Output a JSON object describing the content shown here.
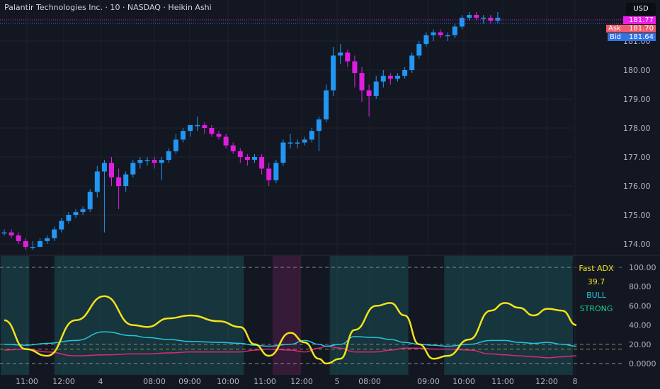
{
  "header": {
    "title": "Palantir Technologies Inc. · 10 · NASDAQ · Heikin Ashi",
    "currency": "USD"
  },
  "quotes": {
    "last": "181.77",
    "ask_label": "Ask",
    "ask": "181.70",
    "bid_label": "Bid",
    "bid": "181.64"
  },
  "colors": {
    "up": "#2196f3",
    "down": "#e01ee0",
    "adx": "#f5e21b",
    "plus_di": "#26c6da",
    "minus_di": "#e0287a",
    "last": "#e91ee9",
    "ask": "#f05a6a",
    "bid": "#2f74e8"
  },
  "price_axis": [
    "181.00",
    "180.00",
    "179.00",
    "178.00",
    "177.00",
    "176.00",
    "175.00",
    "174.00"
  ],
  "osc_axis": [
    "100.00",
    "80.00",
    "60.00",
    "40.00",
    "20.00",
    "0.0000"
  ],
  "time_axis": [
    "11:00",
    "12:00",
    "4",
    "08:00",
    "09:00",
    "10:00",
    "11:00",
    "12:00",
    "5",
    "08:00",
    "09:00",
    "10:00",
    "11:00",
    "12:00",
    "8"
  ],
  "indicator": {
    "name": "Fast ADX",
    "value": "39.7",
    "direction": "BULL",
    "strength": "STRONG"
  },
  "chart_data": {
    "type": "candlestick",
    "candles": [
      [
        174.4,
        174.5,
        174.3,
        174.4
      ],
      [
        174.4,
        174.5,
        174.2,
        174.3
      ],
      [
        174.3,
        174.4,
        174.0,
        174.1
      ],
      [
        174.1,
        174.2,
        173.8,
        173.9
      ],
      [
        173.9,
        174.1,
        173.8,
        173.9
      ],
      [
        173.9,
        174.2,
        173.9,
        174.1
      ],
      [
        174.1,
        174.3,
        174.0,
        174.2
      ],
      [
        174.2,
        174.6,
        174.1,
        174.5
      ],
      [
        174.5,
        174.9,
        174.4,
        174.8
      ],
      [
        174.8,
        175.1,
        174.7,
        175.0
      ],
      [
        175.0,
        175.2,
        174.9,
        175.1
      ],
      [
        175.1,
        175.3,
        175.0,
        175.2
      ],
      [
        175.2,
        175.9,
        175.1,
        175.8
      ],
      [
        175.8,
        176.7,
        175.6,
        176.5
      ],
      [
        176.5,
        176.9,
        174.4,
        176.8
      ],
      [
        176.8,
        177.0,
        176.0,
        176.3
      ],
      [
        176.3,
        176.6,
        175.2,
        176.0
      ],
      [
        176.0,
        176.5,
        175.8,
        176.4
      ],
      [
        176.4,
        176.9,
        176.3,
        176.8
      ],
      [
        176.8,
        177.0,
        176.6,
        176.9
      ],
      [
        176.9,
        177.0,
        176.7,
        176.9
      ],
      [
        176.9,
        177.0,
        176.6,
        176.8
      ],
      [
        176.8,
        177.0,
        176.2,
        176.9
      ],
      [
        176.9,
        177.3,
        176.8,
        177.2
      ],
      [
        177.2,
        177.8,
        177.1,
        177.6
      ],
      [
        177.6,
        178.0,
        177.5,
        177.9
      ],
      [
        177.9,
        178.1,
        177.7,
        178.1
      ],
      [
        178.1,
        178.4,
        177.9,
        178.1
      ],
      [
        178.1,
        178.2,
        177.8,
        178.0
      ],
      [
        178.0,
        178.1,
        177.7,
        177.8
      ],
      [
        177.8,
        177.9,
        177.6,
        177.7
      ],
      [
        177.7,
        177.8,
        177.3,
        177.4
      ],
      [
        177.4,
        177.5,
        177.1,
        177.2
      ],
      [
        177.2,
        177.3,
        176.8,
        177.0
      ],
      [
        177.0,
        177.1,
        176.7,
        176.9
      ],
      [
        176.9,
        177.1,
        176.8,
        177.0
      ],
      [
        177.0,
        177.1,
        176.4,
        176.6
      ],
      [
        176.6,
        176.8,
        176.0,
        176.2
      ],
      [
        176.2,
        176.9,
        176.1,
        176.8
      ],
      [
        176.8,
        177.6,
        176.7,
        177.5
      ],
      [
        177.5,
        177.8,
        177.3,
        177.5
      ],
      [
        177.5,
        177.6,
        177.3,
        177.5
      ],
      [
        177.5,
        177.7,
        177.4,
        177.6
      ],
      [
        177.6,
        178.0,
        177.5,
        177.9
      ],
      [
        177.9,
        178.4,
        177.2,
        178.3
      ],
      [
        178.3,
        179.5,
        178.2,
        179.3
      ],
      [
        179.3,
        180.8,
        179.1,
        180.5
      ],
      [
        180.5,
        180.9,
        180.2,
        180.6
      ],
      [
        180.6,
        180.7,
        180.1,
        180.3
      ],
      [
        180.3,
        180.5,
        179.4,
        179.9
      ],
      [
        179.9,
        180.1,
        178.9,
        179.3
      ],
      [
        179.3,
        179.5,
        178.4,
        179.1
      ],
      [
        179.1,
        179.8,
        179.0,
        179.6
      ],
      [
        179.6,
        180.0,
        179.4,
        179.8
      ],
      [
        179.8,
        179.9,
        179.5,
        179.7
      ],
      [
        179.7,
        179.9,
        179.6,
        179.8
      ],
      [
        179.8,
        180.1,
        179.7,
        180.0
      ],
      [
        180.0,
        180.6,
        179.9,
        180.5
      ],
      [
        180.5,
        181.0,
        180.4,
        180.9
      ],
      [
        180.9,
        181.3,
        180.8,
        181.2
      ],
      [
        181.2,
        181.4,
        181.0,
        181.3
      ],
      [
        181.3,
        181.4,
        181.1,
        181.2
      ],
      [
        181.2,
        181.3,
        181.0,
        181.2
      ],
      [
        181.2,
        181.6,
        181.1,
        181.5
      ],
      [
        181.5,
        181.9,
        181.4,
        181.8
      ],
      [
        181.8,
        182.0,
        181.7,
        181.9
      ],
      [
        181.9,
        182.0,
        181.7,
        181.8
      ],
      [
        181.8,
        181.9,
        181.6,
        181.8
      ],
      [
        181.8,
        181.9,
        181.6,
        181.7
      ],
      [
        181.7,
        182.0,
        181.6,
        181.8
      ]
    ],
    "oscillator": {
      "x_index": [
        0,
        3,
        6,
        10,
        14,
        18,
        20,
        23,
        26,
        30,
        33,
        35,
        37,
        40,
        42,
        44,
        45,
        47,
        49,
        52,
        54,
        56,
        58,
        60,
        62,
        65,
        68,
        70,
        72,
        74,
        76,
        78,
        80
      ],
      "adx": [
        45,
        15,
        8,
        45,
        70,
        40,
        38,
        47,
        50,
        44,
        38,
        20,
        8,
        32,
        22,
        5,
        0,
        5,
        35,
        60,
        63,
        50,
        20,
        5,
        8,
        25,
        55,
        63,
        58,
        50,
        57,
        55,
        40
      ],
      "plus_di": [
        20,
        19,
        21,
        24,
        33,
        29,
        27,
        25,
        23,
        22,
        21,
        19,
        18,
        20,
        24,
        20,
        18,
        20,
        28,
        27,
        25,
        22,
        20,
        19,
        18,
        20,
        24,
        24,
        22,
        21,
        22,
        20,
        18
      ],
      "minus_di": [
        14,
        15,
        12,
        8,
        9,
        10,
        10,
        11,
        12,
        12,
        12,
        14,
        15,
        14,
        12,
        16,
        18,
        16,
        12,
        12,
        14,
        16,
        16,
        15,
        15,
        14,
        10,
        9,
        8,
        7,
        6,
        7,
        8
      ]
    },
    "zones": [
      [
        "bull",
        0,
        4
      ],
      [
        "neutral",
        4,
        7.5
      ],
      [
        "bull",
        7.5,
        34
      ],
      [
        "neutral",
        34,
        38
      ],
      [
        "bear",
        38,
        42
      ],
      [
        "neutral",
        42,
        46
      ],
      [
        "bull",
        46,
        57
      ],
      [
        "neutral",
        57,
        62
      ],
      [
        "bull",
        62,
        80
      ]
    ],
    "price_range": [
      173.5,
      182.3
    ],
    "osc_range": [
      -3,
      110
    ],
    "levels": [
      100,
      20,
      15,
      0
    ]
  }
}
